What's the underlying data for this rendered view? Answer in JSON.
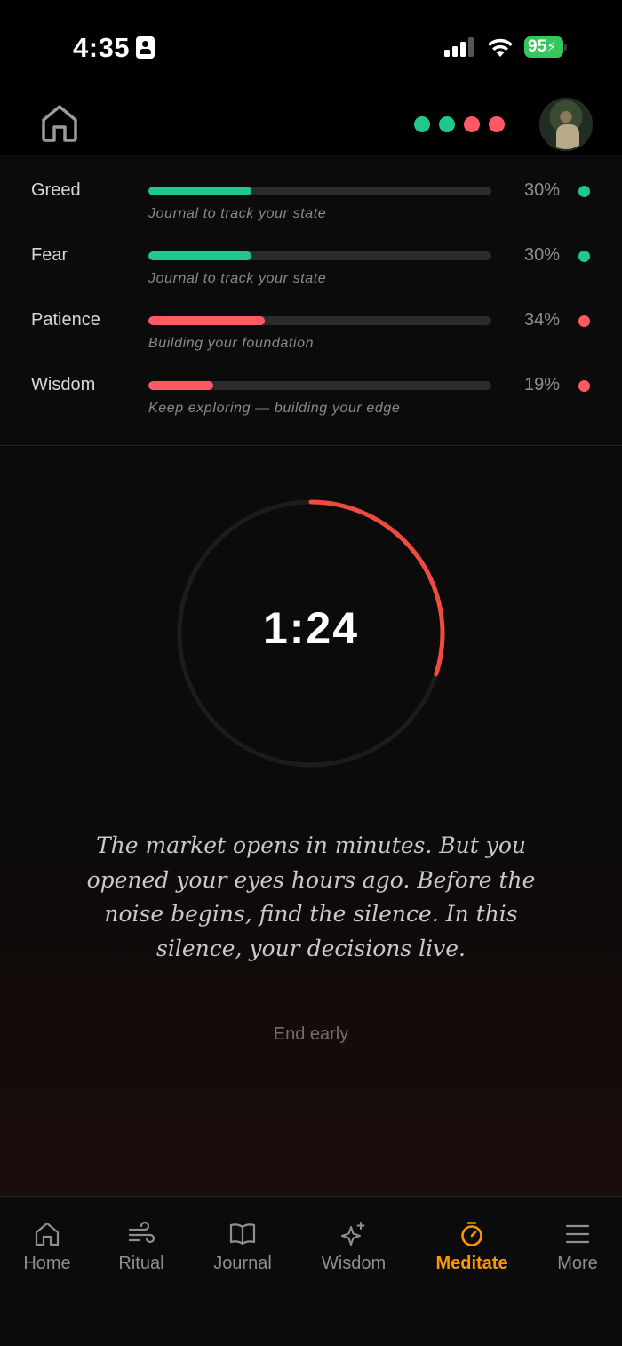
{
  "status_bar": {
    "time": "4:35",
    "battery": "95"
  },
  "header": {
    "dots": [
      "#1ec98a",
      "#1ec98a",
      "#ff5a63",
      "#ff5a63"
    ]
  },
  "emotions": [
    {
      "label": "Greed",
      "percent": "30%",
      "value": 0.3,
      "subtitle": "Journal to track your state",
      "color": "#1ec98a"
    },
    {
      "label": "Fear",
      "percent": "30%",
      "value": 0.3,
      "subtitle": "Journal to track your state",
      "color": "#1ec98a"
    },
    {
      "label": "Patience",
      "percent": "34%",
      "value": 0.34,
      "subtitle": "Building your foundation",
      "color": "#ff5a63"
    },
    {
      "label": "Wisdom",
      "percent": "19%",
      "value": 0.19,
      "subtitle": "Keep exploring — building your edge",
      "color": "#ff5a63"
    }
  ],
  "timer": {
    "display": "1:24",
    "progress": 0.3,
    "ring_color": "#ef4b3f"
  },
  "quote": "The market opens in minutes. But you opened your eyes hours ago. Before the noise begins, find the silence. In this silence, your decisions live.",
  "end_early_label": "End early",
  "tabs": [
    {
      "label": "Home",
      "icon": "home-icon"
    },
    {
      "label": "Ritual",
      "icon": "wind-icon"
    },
    {
      "label": "Journal",
      "icon": "book-icon"
    },
    {
      "label": "Wisdom",
      "icon": "sparkles-icon"
    },
    {
      "label": "Meditate",
      "icon": "timer-icon",
      "active": true
    },
    {
      "label": "More",
      "icon": "menu-icon"
    }
  ],
  "colors": {
    "accent": "#ff9500",
    "positive": "#1ec98a",
    "negative": "#ff5a63"
  }
}
